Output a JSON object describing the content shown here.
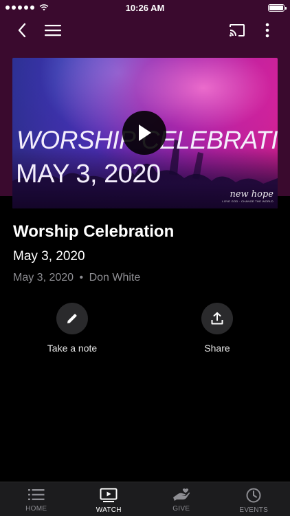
{
  "status_bar": {
    "time": "10:26 AM"
  },
  "header": {
    "back_icon": "chevron-left-icon",
    "menu_icon": "hamburger-menu-icon",
    "cast_icon": "cast-icon",
    "more_icon": "more-vertical-icon"
  },
  "video": {
    "overlay_title": "WORSHIP CELEBRATION",
    "overlay_date": "MAY 3, 2020",
    "brand_name": "new hope",
    "brand_tagline": "LOVE GOD · CHANGE THE WORLD",
    "play_icon": "play-icon"
  },
  "content": {
    "title": "Worship Celebration",
    "subtitle": "May 3, 2020",
    "meta_date": "May 3, 2020",
    "meta_bullet": "•",
    "meta_speaker": "Don White"
  },
  "actions": [
    {
      "label": "Take a note",
      "icon": "pencil-icon"
    },
    {
      "label": "Share",
      "icon": "share-icon"
    }
  ],
  "tabs": [
    {
      "label": "HOME",
      "icon": "list-icon",
      "active": false
    },
    {
      "label": "WATCH",
      "icon": "video-play-icon",
      "active": true
    },
    {
      "label": "GIVE",
      "icon": "giving-hand-icon",
      "active": false
    },
    {
      "label": "EVENTS",
      "icon": "clock-icon",
      "active": false
    }
  ],
  "colors": {
    "header_background": "#3a0a2e",
    "page_background": "#000000",
    "tab_bar_background": "#1c1c1e",
    "muted_text": "#8e8e93",
    "action_circle": "#2a2a2c"
  }
}
